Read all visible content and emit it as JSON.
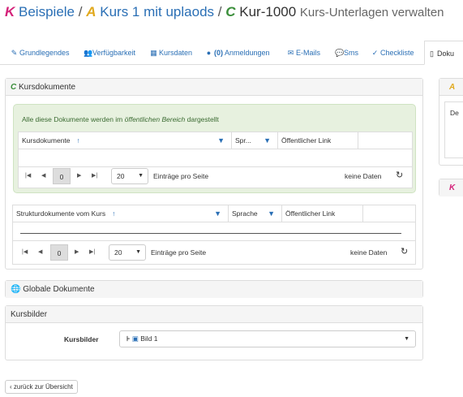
{
  "header": {
    "k_letter": "K",
    "k_label": "Beispiele",
    "a_letter": "A",
    "a_label": "Kurs 1 mit uplaods",
    "c_letter": "C",
    "c_label": "Kur-1000",
    "subtitle": "Kurs-Unterlagen verwalten",
    "separator": "/"
  },
  "tabs": [
    {
      "label": "Grundlegendes",
      "icon": "pencil-icon"
    },
    {
      "label": "Verfügbarkeit",
      "icon": "users-icon"
    },
    {
      "label": "Kursdaten",
      "icon": "calendar-icon"
    },
    {
      "label_count": "(0)",
      "label": "Anmeldungen",
      "icon": "user-icon"
    },
    {
      "label": "E-Mails",
      "icon": "envelope-icon"
    },
    {
      "label": "Sms",
      "icon": "chat-icon"
    },
    {
      "label": "Checkliste",
      "icon": "check-icon"
    },
    {
      "label": "Doku",
      "icon": "file-icon",
      "active": true
    }
  ],
  "kursdokumente": {
    "letter": "C",
    "title": "Kursdokumente",
    "info_prefix": "Alle diese Dokumente werden im ",
    "info_em": "öffentlichen Bereich",
    "info_suffix": " dargestellt",
    "columns": [
      "Kursdokumente",
      "Spr...",
      "Öffentlicher Link"
    ],
    "page": "0",
    "page_size": "20",
    "page_size_label": "Einträge pro Seite",
    "empty": "keine Daten"
  },
  "strukturdokumente": {
    "columns": [
      "Strukturdokumente vom Kurs",
      "Sprache",
      "Öffentlicher Link"
    ],
    "page": "0",
    "page_size": "20",
    "page_size_label": "Einträge pro Seite",
    "empty": "keine Daten"
  },
  "global_docs": {
    "title": "Globale Dokumente"
  },
  "kursbilder": {
    "title": "Kursbilder",
    "field_label": "Kursbilder",
    "value": "Bild 1"
  },
  "side": {
    "a_letter": "A",
    "k_letter": "K",
    "de_text": "De"
  },
  "back_button": "zurück zur Übersicht",
  "colors": {
    "link": "#2a6fb5",
    "k": "#d4237a",
    "a": "#e1a91e",
    "c": "#3a8e3a",
    "info_bg": "#e7f1df"
  }
}
